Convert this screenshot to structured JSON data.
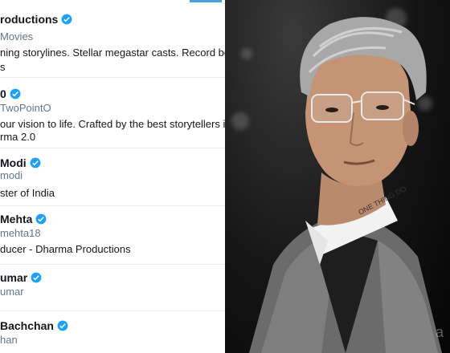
{
  "accounts": [
    {
      "name": "roductions",
      "handle": "Movies",
      "bio": "ning storylines. Stellar megastar casts. Record bo:",
      "bio2": "s",
      "verified": true
    },
    {
      "name": "0",
      "handle": "TwoPointO",
      "bio": "our vision to life. Crafted by the best storytellers ir",
      "bio2": "rma 2.0",
      "verified": true
    },
    {
      "name": "Modi",
      "handle": "modi",
      "bio": "ster of India",
      "verified": true
    },
    {
      "name": "Mehta",
      "handle": "mehta18",
      "bio": "ducer - Dharma Productions",
      "verified": true
    },
    {
      "name": "umar",
      "handle": "umar",
      "verified": true
    },
    {
      "name": "Bachchan",
      "handle": "han",
      "verified": true
    }
  ],
  "photo": {
    "collar_text": "ONE THING DO",
    "watermark": "a"
  },
  "colors": {
    "verified_blue": "#1da1f2",
    "tab_accent": "#4aa3df"
  }
}
